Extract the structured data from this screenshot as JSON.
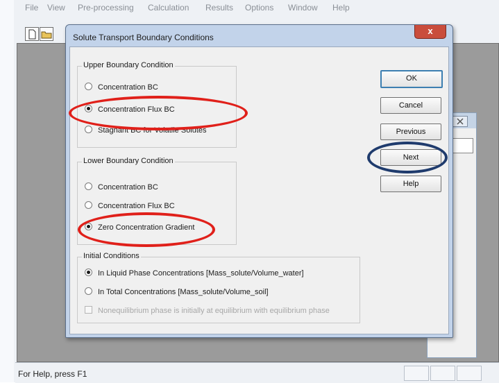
{
  "menubar": {
    "items": [
      "File",
      "View",
      "Pre-processing",
      "Calculation",
      "Results",
      "Options",
      "Window",
      "Help"
    ]
  },
  "toolbar": {
    "buttons": [
      "new-document-icon",
      "open-folder-icon"
    ]
  },
  "dialog": {
    "title": "Solute Transport Boundary Conditions",
    "close_label": "x",
    "upper_group": {
      "label": "Upper Boundary Condition",
      "options": [
        "Concentration BC",
        "Concentration Flux BC",
        "Stagnant BC for Volatile Solutes"
      ],
      "selected": "Concentration Flux BC"
    },
    "lower_group": {
      "label": "Lower Boundary Condition",
      "options": [
        "Concentration BC",
        "Concentration Flux BC",
        "Zero Concentration Gradient"
      ],
      "selected": "Zero Concentration Gradient"
    },
    "initial_group": {
      "label": "Initial Conditions",
      "options": [
        "In Liquid Phase Concentrations [Mass_solute/Volume_water]",
        "In Total Concentrations [Mass_solute/Volume_soil]"
      ],
      "selected": "In Liquid Phase Concentrations [Mass_solute/Volume_water]",
      "checkbox_label": "Nonequilibrium phase is initially at equilibrium with equilibrium phase",
      "checkbox_enabled": false,
      "checkbox_checked": false
    },
    "buttons": {
      "ok": "OK",
      "cancel": "Cancel",
      "previous": "Previous",
      "next": "Next",
      "help": "Help"
    }
  },
  "statusbar": {
    "text": "For Help, press F1"
  },
  "colors": {
    "annotation_red": "#e0201a",
    "annotation_blue": "#1f3b6d",
    "dialog_frame": "#c2d3ea",
    "close_button": "#c94d3c"
  }
}
